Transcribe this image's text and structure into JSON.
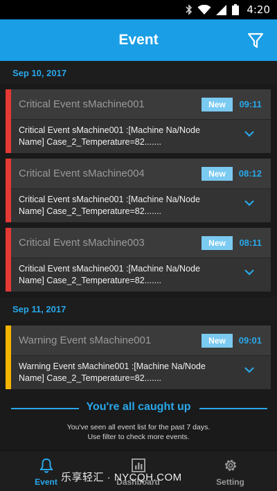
{
  "status_bar": {
    "time": "4:20",
    "icons": [
      "bluetooth-icon",
      "wifi-icon",
      "signal-icon",
      "battery-icon"
    ]
  },
  "app_bar": {
    "title": "Event",
    "filter_icon": "filter-icon"
  },
  "groups": [
    {
      "date": "Sep 10, 2017",
      "events": [
        {
          "title": "Critical Event sMachine001",
          "badge": "New",
          "time": "09:11",
          "detail": "Critical Event sMachine001 :[Machine Na/Node Name] Case_2_Temperature=82.......",
          "severity_color": "#e53935"
        },
        {
          "title": "Critical Event sMachine004",
          "badge": "New",
          "time": "08:12",
          "detail": "Critical Event sMachine001 :[Machine Na/Node Name] Case_2_Temperature=82.......",
          "severity_color": "#e53935"
        },
        {
          "title": "Critical Event sMachine003",
          "badge": "New",
          "time": "08:11",
          "detail": "Critical Event sMachine001 :[Machine Na/Node Name] Case_2_Temperature=82.......",
          "severity_color": "#e53935"
        }
      ]
    },
    {
      "date": "Sep 11, 2017",
      "events": [
        {
          "title": "Warning Event sMachine001",
          "badge": "New",
          "time": "09:01",
          "detail": "Warning Event sMachine001 :[Machine Na/Node Name] Case_2_Temperature=82.......",
          "severity_color": "#f5b400"
        }
      ]
    }
  ],
  "footer": {
    "caught_up": "You're all caught up",
    "line1": "You've seen all event list for the past 7 days.",
    "line2": "Use filter to check more events."
  },
  "tabs": [
    {
      "label": "Event",
      "icon": "bell-icon",
      "active": true
    },
    {
      "label": "Dashboard",
      "icon": "dashboard-icon",
      "active": false
    },
    {
      "label": "Setting",
      "icon": "gear-icon",
      "active": false
    }
  ],
  "watermark": "乐享轻汇 · NYCQH.COM",
  "colors": {
    "accent": "#1a9ee6",
    "critical": "#e53935",
    "warning": "#f5b400",
    "badge": "#7bcaf2"
  }
}
